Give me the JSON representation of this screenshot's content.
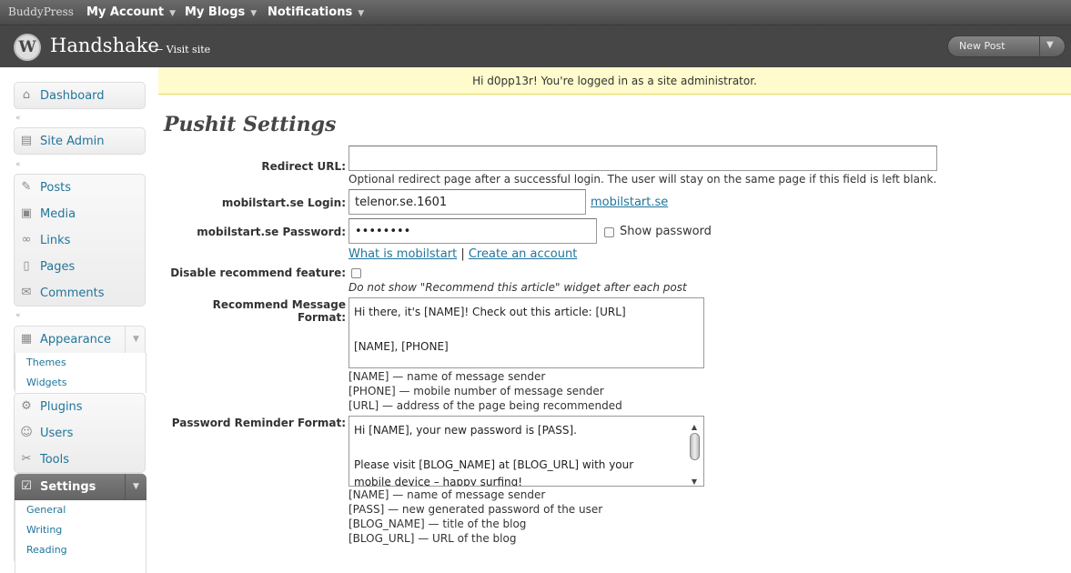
{
  "buddypress_bar": {
    "logo": "BuddyPress",
    "menus": [
      "My Account",
      "My Blogs",
      "Notifications"
    ]
  },
  "header": {
    "site_title": "Handshake",
    "visit_site": "← Visit site",
    "new_post": "New Post"
  },
  "notice": "Hi d0pp13r! You're logged in as a site administrator.",
  "sidebar": {
    "dashboard": "Dashboard",
    "site_admin": "Site Admin",
    "posts": "Posts",
    "media": "Media",
    "links": "Links",
    "pages": "Pages",
    "comments": "Comments",
    "appearance": "Appearance",
    "appearance_sub": [
      "Themes",
      "Widgets"
    ],
    "plugins": "Plugins",
    "users": "Users",
    "tools": "Tools",
    "settings": "Settings",
    "settings_sub": [
      "General",
      "Writing",
      "Reading"
    ]
  },
  "page_title": "Pushit Settings",
  "form": {
    "redirect_label": "Redirect URL:",
    "redirect_value": "",
    "redirect_desc": "Optional redirect page after a successful login. The user will stay on the same page if this field is left blank.",
    "login_label": "mobilstart.se Login:",
    "login_value": "telenor.se.1601",
    "login_link": "mobilstart.se",
    "password_label": "mobilstart.se Password:",
    "password_value": "••••••••",
    "show_password": "Show password",
    "what_is": "What is mobilstart",
    "separator": "|",
    "create_account": "Create an account",
    "disable_label": "Disable recommend feature:",
    "disable_desc": "Do not show \"Recommend this article\" widget after each post",
    "recommend_label": "Recommend Message Format:",
    "recommend_lines": [
      "Hi there, it's [NAME]! Check out this article: [URL]",
      "",
      "[NAME], [PHONE]"
    ],
    "recommend_help": [
      "[NAME] — name of message sender",
      "[PHONE] — mobile number of message sender",
      "[URL] — address of the page being recommended"
    ],
    "reminder_label": "Password Reminder Format:",
    "reminder_lines": [
      "Hi [NAME], your new password is [PASS].",
      "",
      "Please visit [BLOG_NAME] at [BLOG_URL] with your",
      "mobile device – happy surfing!"
    ],
    "reminder_help": [
      "[NAME] — name of message sender",
      "[PASS] — new generated password of the user",
      "[BLOG_NAME] — title of the blog",
      "[BLOG_URL] — URL of the blog"
    ]
  },
  "colors": {
    "link": "#21759b",
    "notice_bg": "#fffbcc",
    "header_bg": "#464646"
  },
  "icons": [
    "wordpress-logo-icon",
    "house-icon",
    "pushpin-icon",
    "media-icon",
    "link-icon",
    "page-icon",
    "comment-icon",
    "appearance-icon",
    "plugin-icon",
    "users-icon",
    "tools-icon",
    "settings-icon"
  ]
}
